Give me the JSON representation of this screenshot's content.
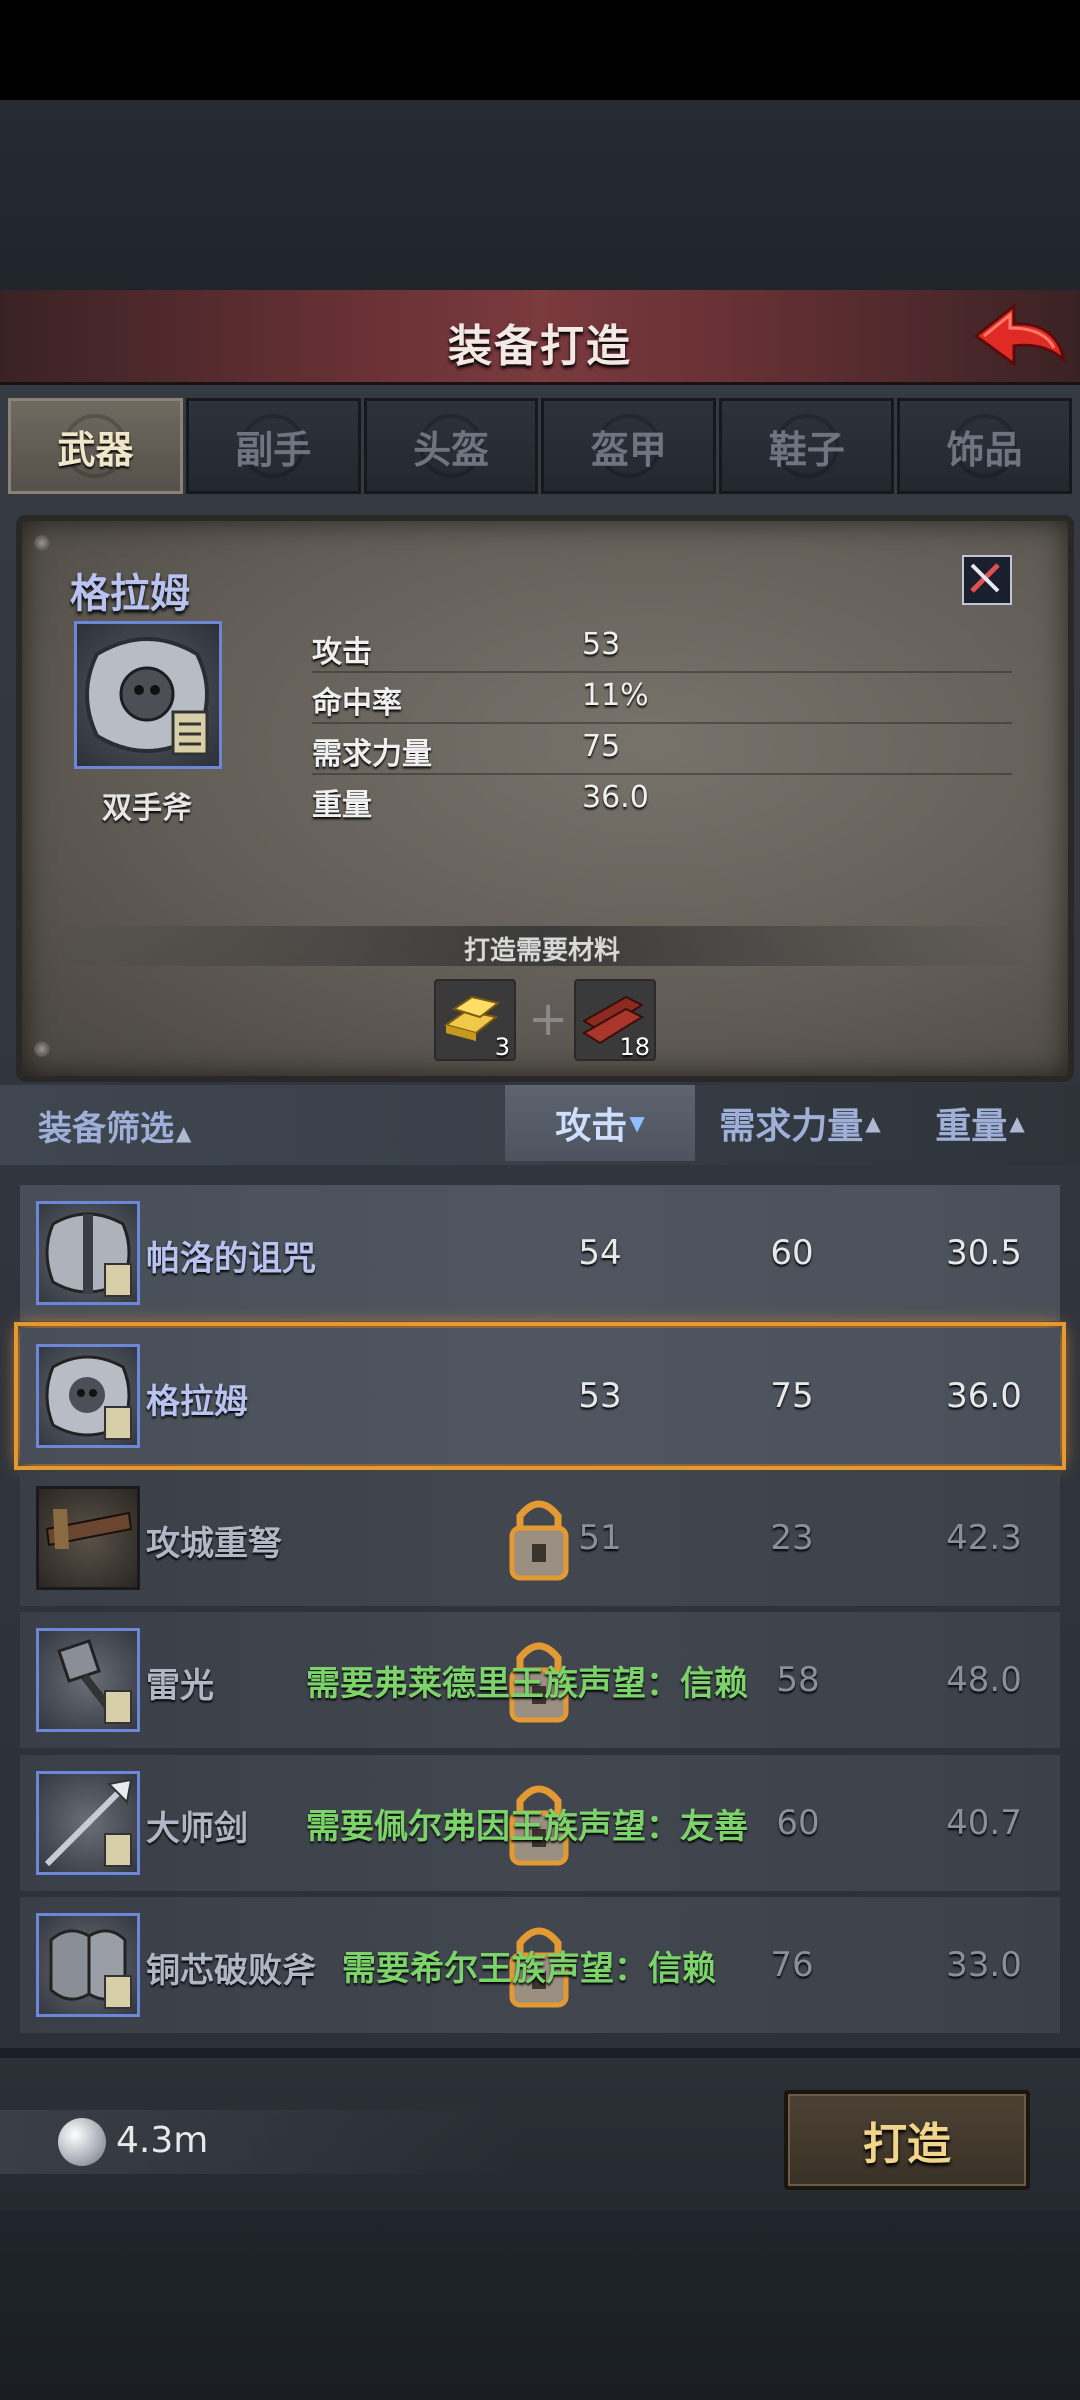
{
  "header": {
    "title": "装备打造"
  },
  "tabs": [
    {
      "label": "武器",
      "active": true
    },
    {
      "label": "副手"
    },
    {
      "label": "头盔"
    },
    {
      "label": "盔甲"
    },
    {
      "label": "鞋子"
    },
    {
      "label": "饰品"
    }
  ],
  "detail": {
    "name": "格拉姆",
    "type": "双手斧",
    "stats": [
      {
        "label": "攻击",
        "value": "53"
      },
      {
        "label": "命中率",
        "value": "11%"
      },
      {
        "label": "需求力量",
        "value": "75"
      },
      {
        "label": "重量",
        "value": "36.0"
      }
    ],
    "materials_title": "打造需要材料",
    "materials": [
      {
        "icon": "gold-ingot-icon",
        "count": "3"
      },
      {
        "icon": "wood-planks-icon",
        "count": "18"
      }
    ]
  },
  "sort": {
    "filter_label": "装备筛选",
    "columns": [
      {
        "label": "攻击",
        "active": true,
        "order": "desc"
      },
      {
        "label": "需求力量"
      },
      {
        "label": "重量"
      }
    ]
  },
  "items": [
    {
      "name": "帕洛的诅咒",
      "attack": "54",
      "strength": "60",
      "weight": "30.5",
      "icon": "battle-axe-icon"
    },
    {
      "name": "格拉姆",
      "attack": "53",
      "strength": "75",
      "weight": "36.0",
      "icon": "skull-axe-icon",
      "selected": true
    },
    {
      "name": "攻城重弩",
      "attack": "51",
      "strength": "23",
      "weight": "42.3",
      "icon": "crossbow-icon",
      "locked": true
    },
    {
      "name": "雷光",
      "attack": "58",
      "strength": "",
      "weight": "48.0",
      "icon": "spiked-mace-icon",
      "locked": true,
      "requirement": "需要弗莱德里王族声望：信赖"
    },
    {
      "name": "大师剑",
      "attack": "60",
      "strength": "",
      "weight": "40.7",
      "icon": "spear-icon",
      "locked": true,
      "requirement": "需要佩尔弗因王族声望：友善"
    },
    {
      "name": "铜芯破败斧",
      "attack": "",
      "strength": "76",
      "weight": "33.0",
      "icon": "ornate-axe-icon",
      "locked": true,
      "requirement": "需要希尔王族声望：信赖"
    }
  ],
  "footer": {
    "currency": "4.3m",
    "craft_label": "打造"
  },
  "colors": {
    "accent": "#e39a33",
    "requirement": "#7bd36a",
    "item_name": "#b8c3f0",
    "header": "#6b3236"
  }
}
